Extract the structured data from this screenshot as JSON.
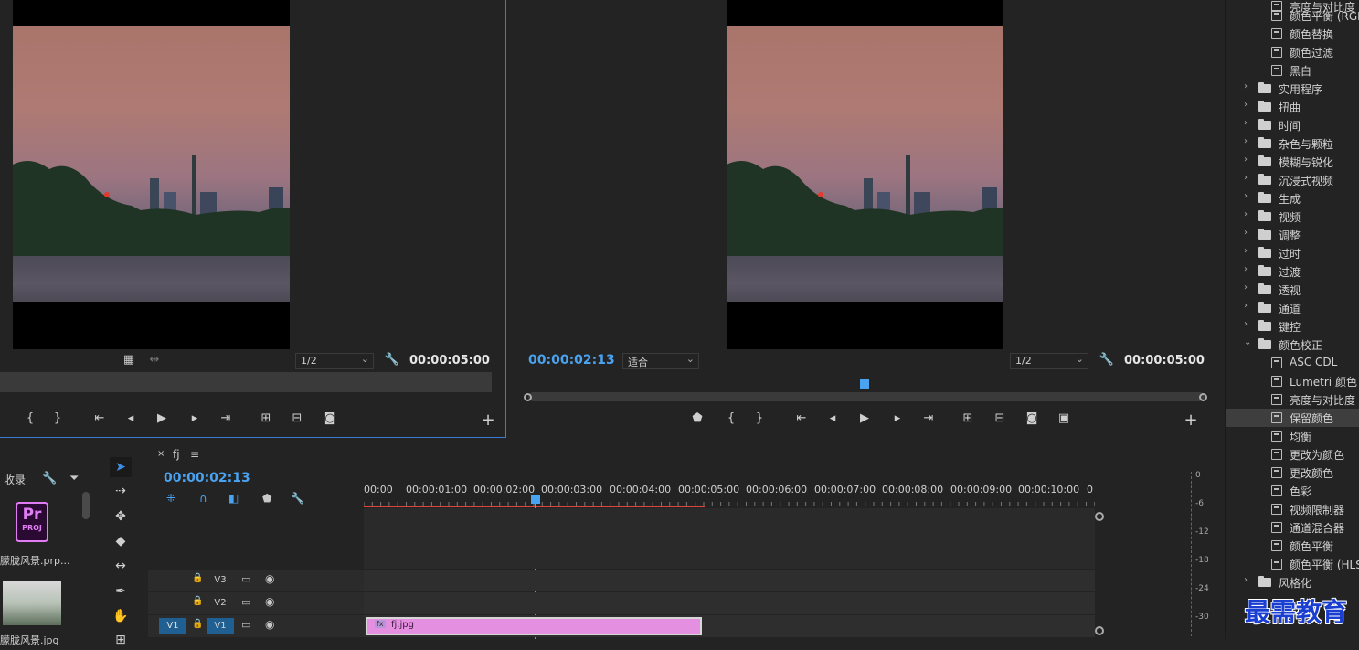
{
  "source_monitor": {
    "resolution": "1/2",
    "duration": "00:00:05:00"
  },
  "program_monitor": {
    "playhead_time": "00:00:02:13",
    "zoom": "适合",
    "resolution": "1/2",
    "duration": "00:00:05:00"
  },
  "effects": {
    "items": [
      {
        "type": "item",
        "label": "颜色平衡 (RGB)"
      },
      {
        "type": "item",
        "label": "颜色替换"
      },
      {
        "type": "item",
        "label": "颜色过滤"
      },
      {
        "type": "item",
        "label": "黑白"
      },
      {
        "type": "folder",
        "label": "实用程序"
      },
      {
        "type": "folder",
        "label": "扭曲"
      },
      {
        "type": "folder",
        "label": "时间"
      },
      {
        "type": "folder",
        "label": "杂色与颗粒"
      },
      {
        "type": "folder",
        "label": "模糊与锐化"
      },
      {
        "type": "folder",
        "label": "沉浸式视频"
      },
      {
        "type": "folder",
        "label": "生成"
      },
      {
        "type": "folder",
        "label": "视频"
      },
      {
        "type": "folder",
        "label": "调整"
      },
      {
        "type": "folder",
        "label": "过时"
      },
      {
        "type": "folder",
        "label": "过渡"
      },
      {
        "type": "folder",
        "label": "透视"
      },
      {
        "type": "folder",
        "label": "通道"
      },
      {
        "type": "folder",
        "label": "键控"
      },
      {
        "type": "folder-open",
        "label": "颜色校正"
      },
      {
        "type": "item",
        "label": "ASC CDL"
      },
      {
        "type": "item",
        "label": "Lumetri 颜色"
      },
      {
        "type": "item",
        "label": "亮度与对比度"
      },
      {
        "type": "item",
        "label": "保留颜色",
        "selected": true
      },
      {
        "type": "item",
        "label": "均衡"
      },
      {
        "type": "item",
        "label": "更改为颜色"
      },
      {
        "type": "item",
        "label": "更改颜色"
      },
      {
        "type": "item",
        "label": "色彩"
      },
      {
        "type": "item",
        "label": "视频限制器"
      },
      {
        "type": "item",
        "label": "通道混合器"
      },
      {
        "type": "item",
        "label": "颜色平衡"
      },
      {
        "type": "item",
        "label": "颜色平衡 (HLS)"
      },
      {
        "type": "folder",
        "label": "风格化"
      }
    ]
  },
  "project": {
    "tab_label": "收录",
    "proj_icon_top": "Pr",
    "proj_icon_bottom": "PROJ",
    "proj_name": "朦胧风景.prp...",
    "clip_name": "朦胧风景.jpg"
  },
  "timeline": {
    "sequence_name": "fj",
    "timecode": "00:00:02:13",
    "ruler": [
      "00:00",
      "00:00:01:00",
      "00:00:02:00",
      "00:00:03:00",
      "00:00:04:00",
      "00:00:05:00",
      "00:00:06:00",
      "00:00:07:00",
      "00:00:08:00",
      "00:00:09:00",
      "00:00:10:00",
      "0"
    ],
    "tracks": [
      {
        "name": "V3"
      },
      {
        "name": "V2"
      },
      {
        "name": "V1",
        "source": "V1"
      }
    ],
    "clip": {
      "label": "fj.jpg",
      "fx": "fx",
      "color": "#e58fe0"
    }
  },
  "meter": {
    "scale": [
      "0",
      "-6",
      "-12",
      "-18",
      "-24",
      "-30"
    ]
  },
  "watermark": "最需教育"
}
